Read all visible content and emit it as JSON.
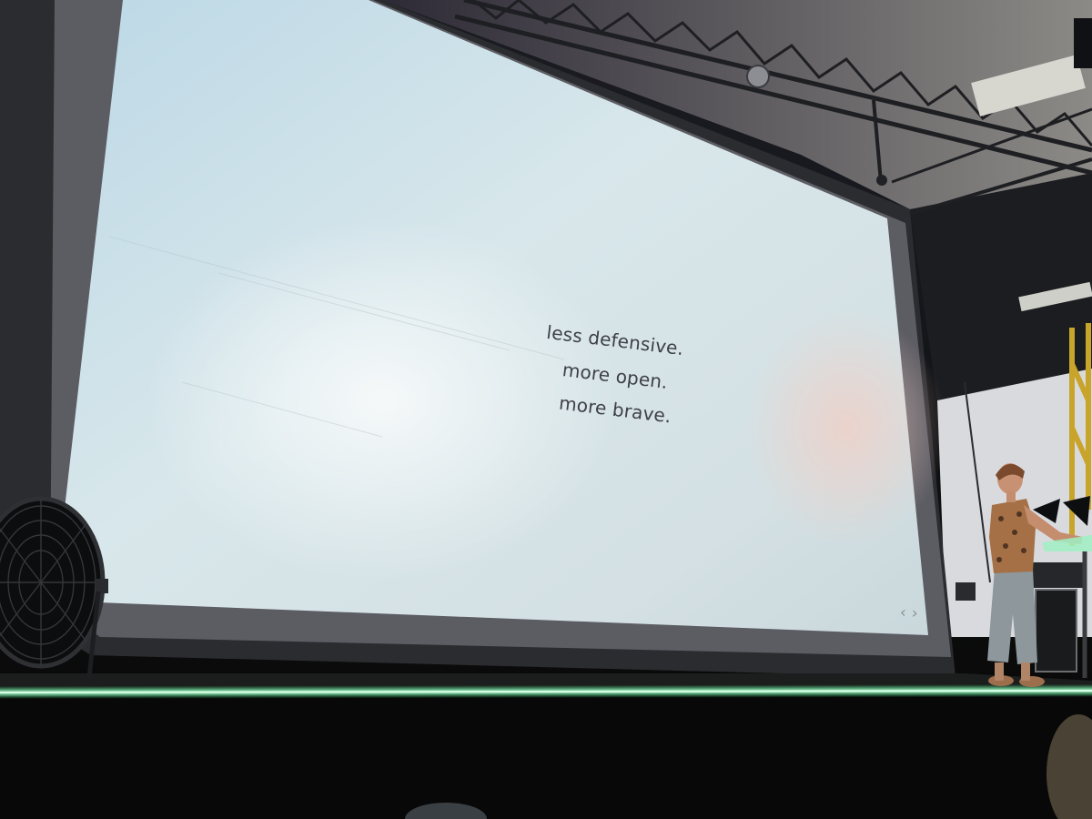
{
  "slide": {
    "lines": [
      "less defensive.",
      "more open.",
      "more brave."
    ],
    "prev_arrow": "‹",
    "next_arrow": "›"
  },
  "colors": {
    "screen": "#cfe0e6",
    "slide_text": "#3e3f48",
    "stage_led": "#3df58a",
    "truss": "#232428",
    "stage_floor": "#070807"
  },
  "icons": {
    "fan": "floor-fan-icon",
    "prev": "chevron-left-icon",
    "next": "chevron-right-icon"
  }
}
